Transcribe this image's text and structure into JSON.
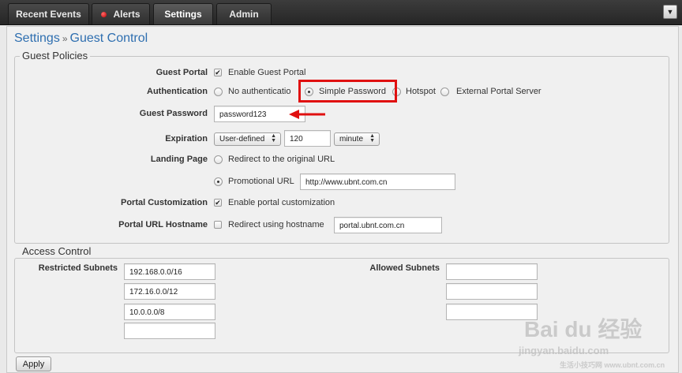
{
  "tabs": [
    {
      "label": "Recent Events"
    },
    {
      "label": "Alerts"
    },
    {
      "label": "Settings"
    },
    {
      "label": "Admin"
    }
  ],
  "menu_icon": "chevron-down-icon",
  "breadcrumb": {
    "root": "Settings",
    "separator": "»",
    "current": "Guest Control"
  },
  "guest_policies": {
    "legend": "Guest Policies",
    "guest_portal": {
      "label": "Guest Portal",
      "checkbox_text": "Enable Guest Portal",
      "checked": true
    },
    "authentication": {
      "label": "Authentication",
      "options": [
        "No authenticatio",
        "Simple Password",
        "Hotspot",
        "External Portal Server"
      ],
      "selected": "Simple Password"
    },
    "guest_password": {
      "label": "Guest Password",
      "value": "password123"
    },
    "expiration": {
      "label": "Expiration",
      "mode": "User-defined",
      "value": "120",
      "unit": "minute"
    },
    "landing_page": {
      "label": "Landing Page",
      "option_original": "Redirect to the original URL",
      "option_promo": "Promotional URL",
      "promo_url": "http://www.ubnt.com.cn",
      "selected": "Promotional URL"
    },
    "portal_customization": {
      "label": "Portal Customization",
      "checkbox_text": "Enable portal customization",
      "checked": true
    },
    "portal_url_hostname": {
      "label": "Portal URL Hostname",
      "checkbox_text": "Redirect using hostname",
      "checked": false,
      "hostname": "portal.ubnt.com.cn"
    }
  },
  "access_control": {
    "legend": "Access Control",
    "restricted_label": "Restricted Subnets",
    "restricted": [
      "192.168.0.0/16",
      "172.16.0.0/12",
      "10.0.0.0/8",
      ""
    ],
    "allowed_label": "Allowed Subnets",
    "allowed": [
      "",
      "",
      ""
    ]
  },
  "apply_label": "Apply",
  "colors": {
    "highlight": "#e01010",
    "accent_link": "#2f6fb0",
    "alert_dot": "#d00000"
  },
  "watermark": {
    "brand": "Bai  du 经验",
    "url": "jingyan.baidu.com",
    "sub": "生活小技巧网 www.ubnt.com.cn"
  }
}
